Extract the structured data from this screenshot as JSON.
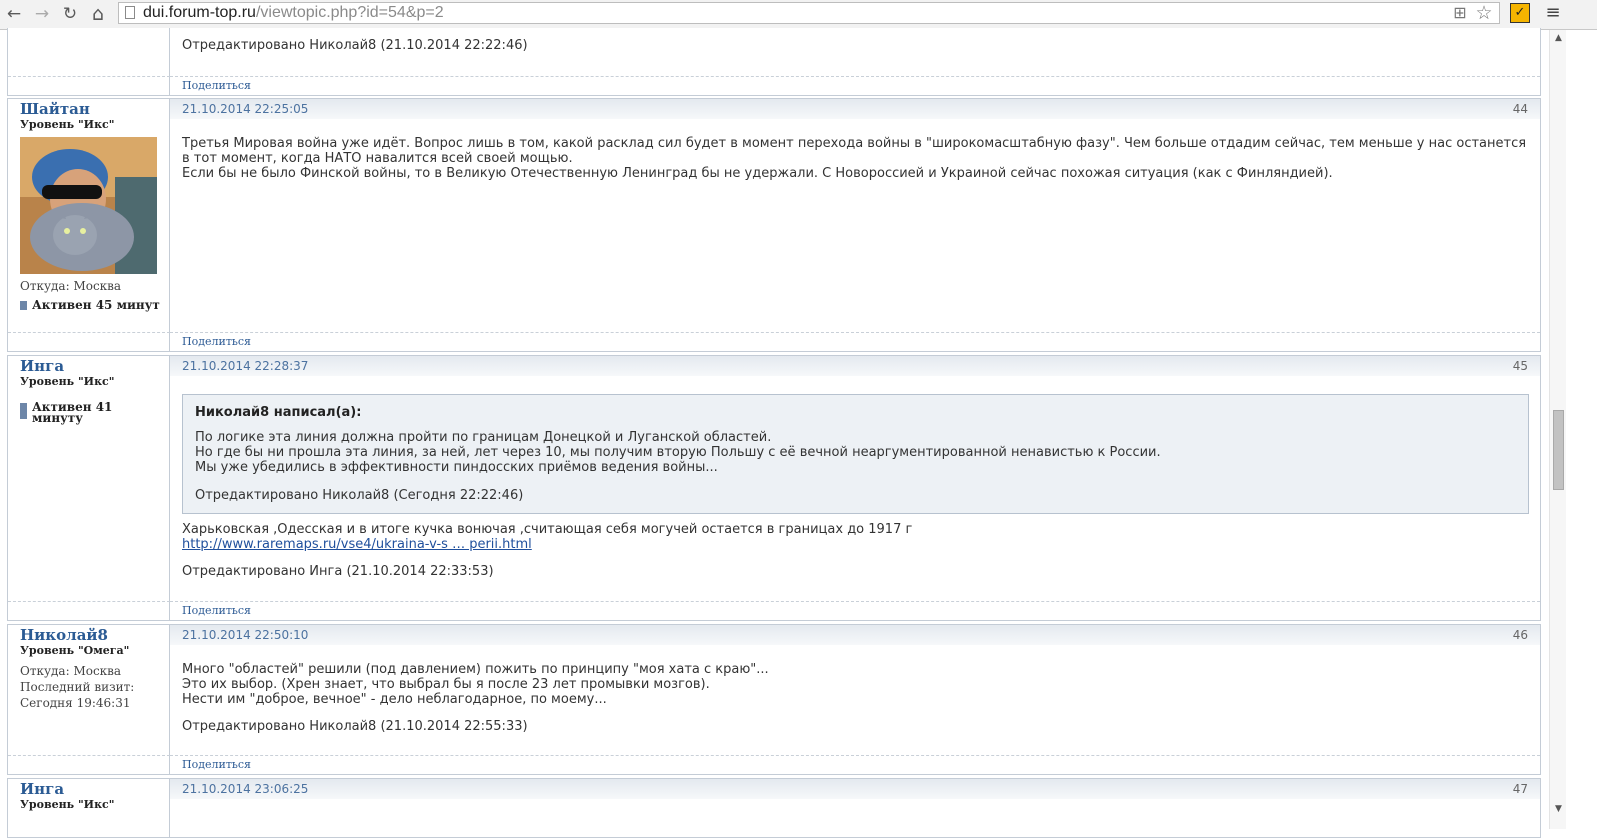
{
  "browser": {
    "url_host": "dui.forum-top.ru",
    "url_path": "/viewtopic.php?id=54&p=2",
    "back_icon": "←",
    "forward_icon": "→",
    "reload_icon": "↻",
    "home_icon": "⌂",
    "translate_icon": "⊞",
    "star_icon": "☆",
    "ext_icon": "✓",
    "menu_icon": "≡"
  },
  "scrollbar": {
    "up": "▲",
    "down": "▼"
  },
  "top_fragment": {
    "edited": "Отредактировано Николай8 (21.10.2014 22:22:46)",
    "share": "Поделиться"
  },
  "posts": [
    {
      "username": "Шайтан",
      "rank": "Уровень \"Икс\"",
      "location": "Откуда: Москва",
      "active": "Активен 45 минут",
      "date": "21.10.2014 22:25:05",
      "number": "44",
      "body": [
        "Третья Мировая война уже идёт. Вопрос лишь в том, какой расклад сил будет в момент перехода войны в \"широкомасштабную фазу\". Чем больше отдадим сейчас, тем меньше у нас останется в тот момент, когда НАТО навалится всей своей мощью.",
        "Если бы не было Финской войны, то в Великую Отечественную Ленинград бы не удержали. С Новороссией и Украиной сейчас похожая ситуация (как с Финляндией)."
      ],
      "share": "Поделиться"
    },
    {
      "username": "Инга",
      "rank": "Уровень \"Икс\"",
      "active_line1": "Активен 41",
      "active_line2": "минуту",
      "date": "21.10.2014 22:28:37",
      "number": "45",
      "quote_author": "Николай8 написал(а):",
      "quote_lines": [
        "По логике эта линия должна пройти по границам Донецкой и Луганской областей.",
        "Но где бы ни прошла эта линия, за ней, лет через 10, мы получим вторую Польшу с её вечной неаргументированной ненавистью к России.",
        "Мы уже убедились в эффективности пиндосских приёмов ведения войны..."
      ],
      "quote_edited": "Отредактировано Николай8 (Сегодня 22:22:46)",
      "body": "Харьковская ,Одесская и в итоге кучка вонючая ,считающая себя могучей остается в границах до 1917 г",
      "link": "http://www.raremaps.ru/vse4/ukraina-v-s … perii.html",
      "edited": "Отредактировано Инга (21.10.2014 22:33:53)",
      "share": "Поделиться"
    },
    {
      "username": "Николай8",
      "rank": "Уровень \"Омега\"",
      "location": "Откуда: Москва",
      "last_visit_label": "Последний визит:",
      "last_visit_value": "Сегодня 19:46:31",
      "date": "21.10.2014 22:50:10",
      "number": "46",
      "body": [
        "Много \"областей\" решили (под давлением) пожить по принципу \"моя хата с краю\"...",
        "Это их выбор. (Хрен знает, что выбрал бы я после 23 лет промывки мозгов).",
        "Нести им \"доброе, вечное\" - дело неблагодарное, по моему..."
      ],
      "edited": "Отредактировано Николай8 (21.10.2014 22:55:33)",
      "share": "Поделиться"
    },
    {
      "username": "Инга",
      "rank": "Уровень \"Икс\"",
      "date": "21.10.2014 23:06:25",
      "number": "47"
    }
  ]
}
